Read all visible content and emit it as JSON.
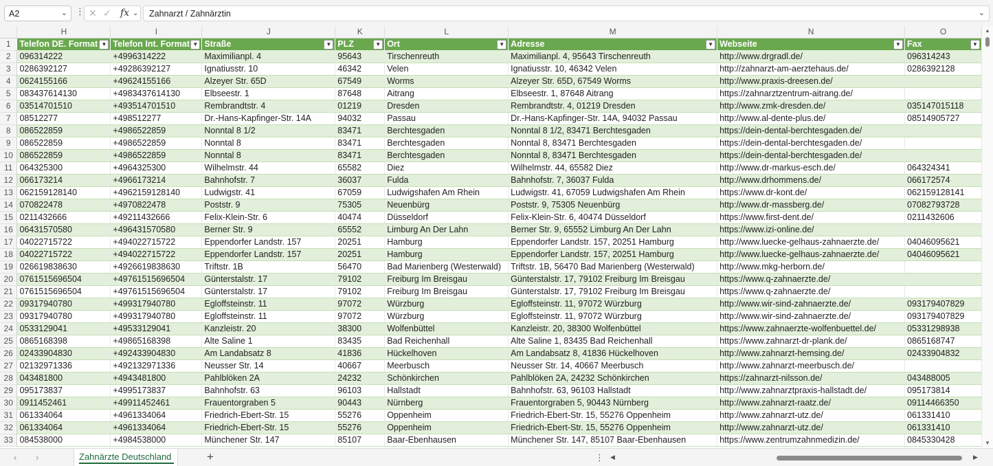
{
  "formula_bar": {
    "name_box": "A2",
    "fx_label": "fx",
    "formula": "Zahnarzt / Zahnärztin"
  },
  "columns": [
    "H",
    "I",
    "J",
    "K",
    "L",
    "M",
    "N",
    "O"
  ],
  "headers": [
    "Telefon DE. Format",
    "Telefon Int. Format",
    "Straße",
    "PLZ",
    "Ort",
    "Adresse",
    "Webseite",
    "Fax"
  ],
  "rows": [
    [
      "096314222",
      "+4996314222",
      "Maximilianpl. 4",
      "95643",
      "Tirschenreuth",
      "Maximilianpl. 4, 95643 Tirschenreuth",
      "http://www.drgradl.de/",
      "096314243"
    ],
    [
      "0286392127",
      "+49286392127",
      "Ignatiusstr. 10",
      "46342",
      "Velen",
      "Ignatiusstr. 10, 46342 Velen",
      "http://zahnarzt-am-aerztehaus.de/",
      "0286392128"
    ],
    [
      "0624155166",
      "+49624155166",
      "Alzeyer Str. 65D",
      "67549",
      "Worms",
      "Alzeyer Str. 65D, 67549 Worms",
      "http://www.praxis-dreesen.de/",
      ""
    ],
    [
      "083437614130",
      "+4983437614130",
      "Elbseestr. 1",
      "87648",
      "Aitrang",
      "Elbseestr. 1, 87648 Aitrang",
      "https://zahnarztzentrum-aitrang.de/",
      ""
    ],
    [
      "03514701510",
      "+493514701510",
      "Rembrandtstr. 4",
      "01219",
      "Dresden",
      "Rembrandtstr. 4, 01219 Dresden",
      "http://www.zmk-dresden.de/",
      "035147015118"
    ],
    [
      "08512277",
      "+498512277",
      "Dr.-Hans-Kapfinger-Str. 14A",
      "94032",
      "Passau",
      "Dr.-Hans-Kapfinger-Str. 14A, 94032 Passau",
      "http://www.al-dente-plus.de/",
      "08514905727"
    ],
    [
      "086522859",
      "+4986522859",
      "Nonntal 8 1/2",
      "83471",
      "Berchtesgaden",
      "Nonntal 8 1/2, 83471 Berchtesgaden",
      "https://dein-dental-berchtesgaden.de/",
      ""
    ],
    [
      "086522859",
      "+4986522859",
      "Nonntal 8",
      "83471",
      "Berchtesgaden",
      "Nonntal 8, 83471 Berchtesgaden",
      "https://dein-dental-berchtesgaden.de/",
      ""
    ],
    [
      "086522859",
      "+4986522859",
      "Nonntal 8",
      "83471",
      "Berchtesgaden",
      "Nonntal 8, 83471 Berchtesgaden",
      "https://dein-dental-berchtesgaden.de/",
      ""
    ],
    [
      "064325300",
      "+4964325300",
      "Wilhelmstr. 44",
      "65582",
      "Diez",
      "Wilhelmstr. 44, 65582 Diez",
      "http://www.dr-markus-esch.de/",
      "064324341"
    ],
    [
      "066173214",
      "+4966173214",
      "Bahnhofstr. 7",
      "36037",
      "Fulda",
      "Bahnhofstr. 7, 36037 Fulda",
      "http://www.drhommens.de/",
      "066172574"
    ],
    [
      "062159128140",
      "+4962159128140",
      "Ludwigstr. 41",
      "67059",
      "Ludwigshafen Am Rhein",
      "Ludwigstr. 41, 67059 Ludwigshafen Am Rhein",
      "https://www.dr-kont.de/",
      "062159128141"
    ],
    [
      "070822478",
      "+4970822478",
      "Poststr. 9",
      "75305",
      "Neuenbürg",
      "Poststr. 9, 75305 Neuenbürg",
      "http://www.dr-massberg.de/",
      "07082793728"
    ],
    [
      "0211432666",
      "+49211432666",
      "Felix-Klein-Str. 6",
      "40474",
      "Düsseldorf",
      "Felix-Klein-Str. 6, 40474 Düsseldorf",
      "https://www.first-dent.de/",
      "0211432606"
    ],
    [
      "06431570580",
      "+496431570580",
      "Berner Str. 9",
      "65552",
      "Limburg An Der Lahn",
      "Berner Str. 9, 65552 Limburg An Der Lahn",
      "https://www.izi-online.de/",
      ""
    ],
    [
      "04022715722",
      "+494022715722",
      "Eppendorfer Landstr. 157",
      "20251",
      "Hamburg",
      "Eppendorfer Landstr. 157, 20251 Hamburg",
      "http://www.luecke-gelhaus-zahnaerzte.de/",
      "04046095621"
    ],
    [
      "04022715722",
      "+494022715722",
      "Eppendorfer Landstr. 157",
      "20251",
      "Hamburg",
      "Eppendorfer Landstr. 157, 20251 Hamburg",
      "http://www.luecke-gelhaus-zahnaerzte.de/",
      "04046095621"
    ],
    [
      "026619838630",
      "+4926619838630",
      "Triftstr. 1B",
      "56470",
      "Bad Marienberg (Westerwald)",
      "Triftstr. 1B, 56470 Bad Marienberg (Westerwald)",
      "http://www.mkg-herborn.de/",
      ""
    ],
    [
      "0761515696504",
      "+49761515696504",
      "Günterstalstr. 17",
      "79102",
      "Freiburg Im Breisgau",
      "Günterstalstr. 17, 79102 Freiburg Im Breisgau",
      "https://www.q-zahnaerzte.de/",
      ""
    ],
    [
      "0761515696504",
      "+49761515696504",
      "Günterstalstr. 17",
      "79102",
      "Freiburg Im Breisgau",
      "Günterstalstr. 17, 79102 Freiburg Im Breisgau",
      "https://www.q-zahnaerzte.de/",
      ""
    ],
    [
      "09317940780",
      "+499317940780",
      "Egloffsteinstr. 11",
      "97072",
      "Würzburg",
      "Egloffsteinstr. 11, 97072 Würzburg",
      "http://www.wir-sind-zahnaerzte.de/",
      "093179407829"
    ],
    [
      "09317940780",
      "+499317940780",
      "Egloffsteinstr. 11",
      "97072",
      "Würzburg",
      "Egloffsteinstr. 11, 97072 Würzburg",
      "http://www.wir-sind-zahnaerzte.de/",
      "093179407829"
    ],
    [
      "0533129041",
      "+49533129041",
      "Kanzleistr. 20",
      "38300",
      "Wolfenbüttel",
      "Kanzleistr. 20, 38300 Wolfenbüttel",
      "https://www.zahnaerzte-wolfenbuettel.de/",
      "05331298938"
    ],
    [
      "0865168398",
      "+49865168398",
      "Alte Saline 1",
      "83435",
      "Bad Reichenhall",
      "Alte Saline 1, 83435 Bad Reichenhall",
      "https://www.zahnarzt-dr-plank.de/",
      "0865168747"
    ],
    [
      "02433904830",
      "+492433904830",
      "Am Landabsatz 8",
      "41836",
      "Hückelhoven",
      "Am Landabsatz 8, 41836 Hückelhoven",
      "http://www.zahnarzt-hemsing.de/",
      "02433904832"
    ],
    [
      "02132971336",
      "+492132971336",
      "Neusser Str. 14",
      "40667",
      "Meerbusch",
      "Neusser Str. 14, 40667 Meerbusch",
      "http://www.zahnarzt-meerbusch.de/",
      ""
    ],
    [
      "043481800",
      "+4943481800",
      "Pahlblöken 2A",
      "24232",
      "Schönkirchen",
      "Pahlblöken 2A, 24232 Schönkirchen",
      "https://zahnarzt-nilsson.de/",
      "043488005"
    ],
    [
      "095173837",
      "+4995173837",
      "Bahnhofstr. 63",
      "96103",
      "Hallstadt",
      "Bahnhofstr. 63, 96103 Hallstadt",
      "http://www.zahnarztpraxis-hallstadt.de/",
      "095173814"
    ],
    [
      "0911452461",
      "+49911452461",
      "Frauentorgraben 5",
      "90443",
      "Nürnberg",
      "Frauentorgraben 5, 90443 Nürnberg",
      "http://www.zahnarzt-raatz.de/",
      "09114466350"
    ],
    [
      "061334064",
      "+4961334064",
      "Friedrich-Ebert-Str. 15",
      "55276",
      "Oppenheim",
      "Friedrich-Ebert-Str. 15, 55276 Oppenheim",
      "http://www.zahnarzt-utz.de/",
      "061331410"
    ],
    [
      "061334064",
      "+4961334064",
      "Friedrich-Ebert-Str. 15",
      "55276",
      "Oppenheim",
      "Friedrich-Ebert-Str. 15, 55276 Oppenheim",
      "http://www.zahnarzt-utz.de/",
      "061331410"
    ],
    [
      "084538000",
      "+4984538000",
      "Münchener Str. 147",
      "85107",
      "Baar-Ebenhausen",
      "Münchener Str. 147, 85107 Baar-Ebenhausen",
      "https://www.zentrumzahnmedizin.de/",
      "0845330428"
    ]
  ],
  "sheet_tabs": {
    "active": "Zahnärzte Deutschland",
    "add_label": "+"
  },
  "icons": {
    "name_box_dropdown": "chevron-down-icon",
    "more": "more-vertical-icon",
    "cancel": "cancel-x-icon",
    "enter": "check-icon",
    "formula_expand": "chevron-down-icon",
    "filter": "filter-dropdown-icon",
    "tab_prev": "chevron-left-icon",
    "tab_next": "chevron-right-icon"
  },
  "colors": {
    "header_fill": "#6aa84f",
    "band_fill": "#e2efda",
    "tab_accent": "#1e6b3c"
  }
}
